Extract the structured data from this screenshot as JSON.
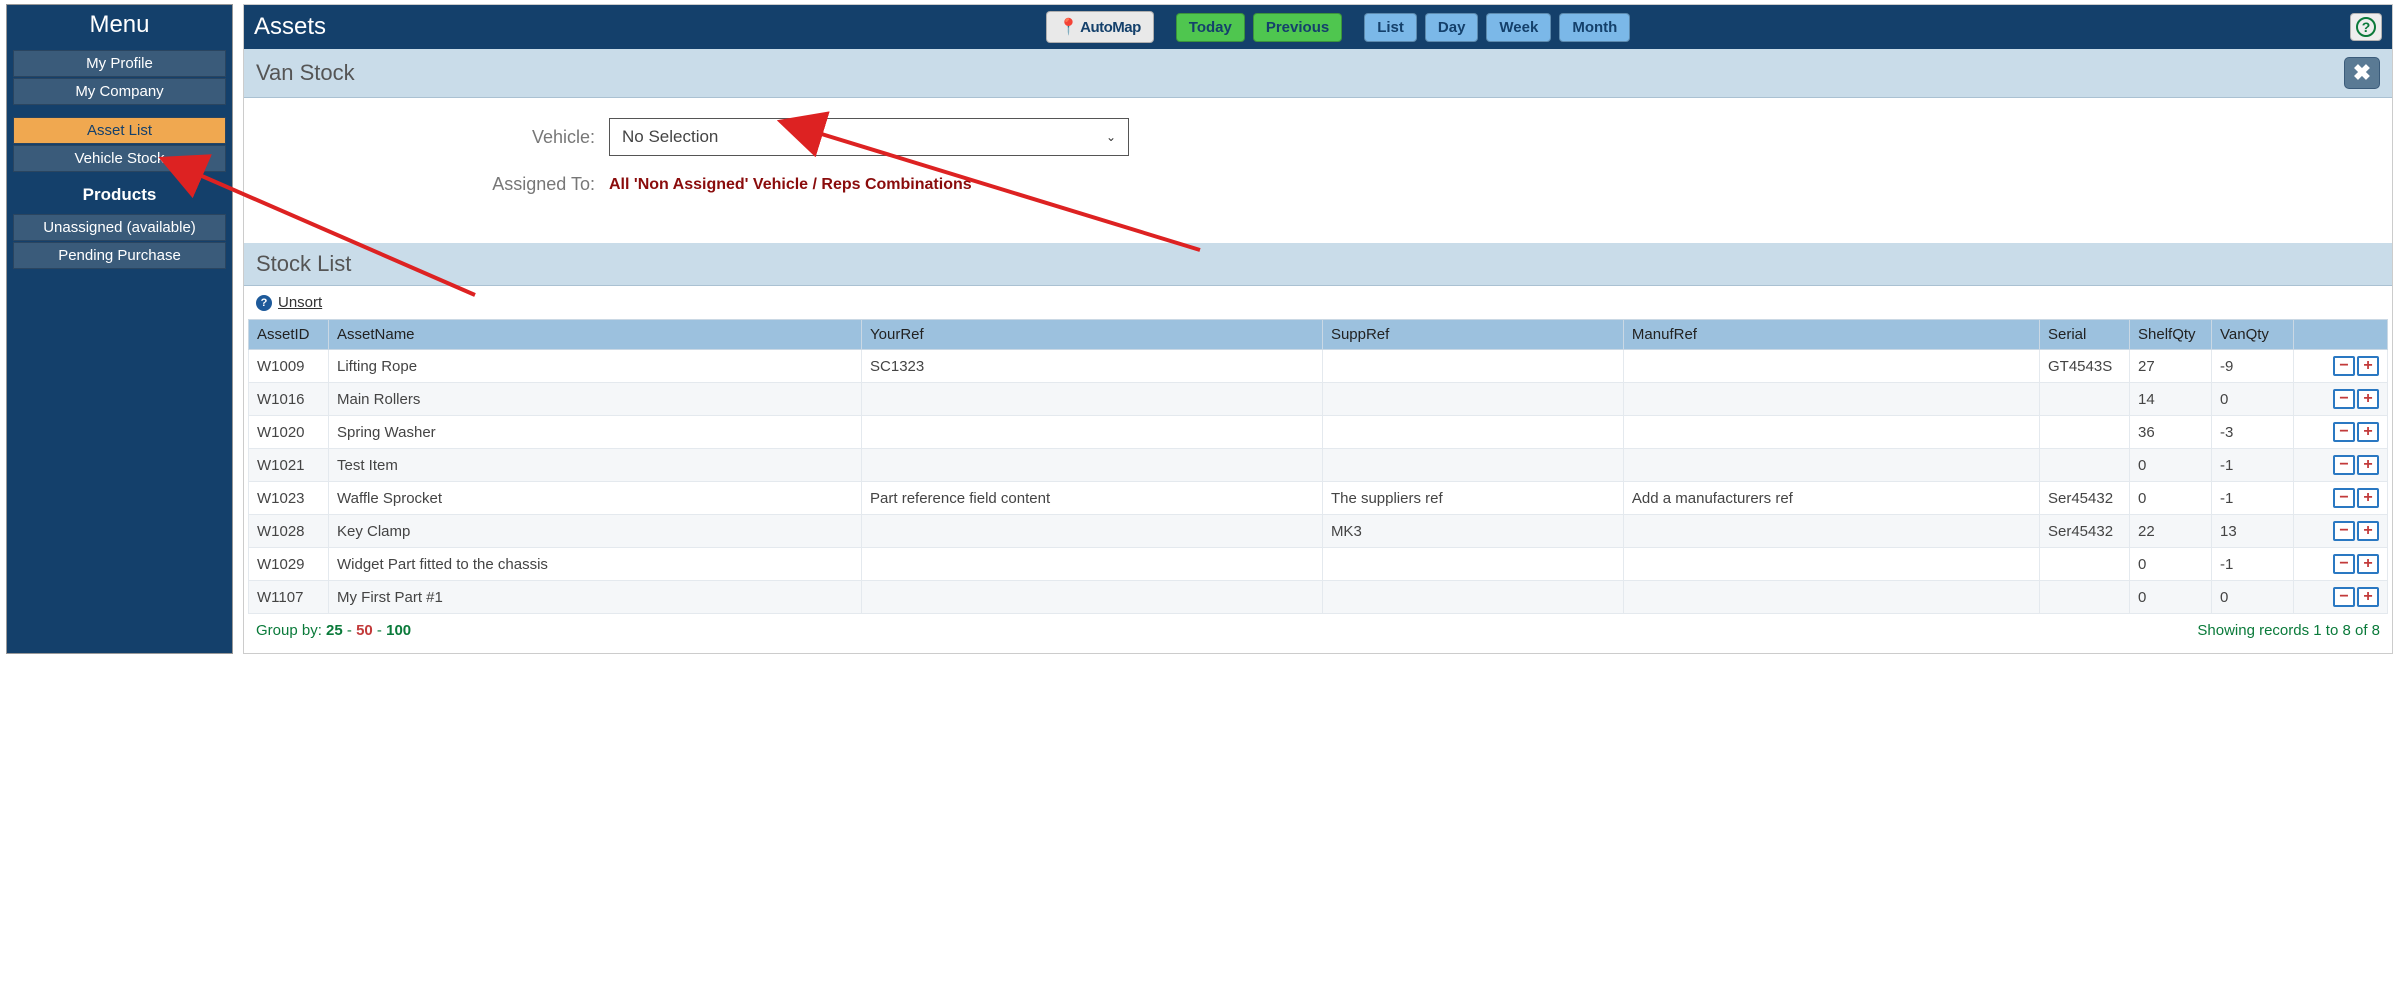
{
  "sidebar": {
    "title": "Menu",
    "items": [
      {
        "label": "My Profile",
        "active": false
      },
      {
        "label": "My Company",
        "active": false
      }
    ],
    "items2": [
      {
        "label": "Asset List",
        "active": true
      },
      {
        "label": "Vehicle Stock",
        "active": false
      }
    ],
    "products_section": "Products",
    "items3": [
      {
        "label": "Unassigned (available)",
        "active": false
      },
      {
        "label": "Pending Purchase",
        "active": false
      }
    ]
  },
  "header": {
    "title": "Assets",
    "automap": "AutoMap",
    "today": "Today",
    "previous": "Previous",
    "list": "List",
    "day": "Day",
    "week": "Week",
    "month": "Month",
    "help": "?"
  },
  "van_stock": {
    "title": "Van Stock",
    "vehicle_label": "Vehicle:",
    "vehicle_value": "No Selection",
    "assigned_label": "Assigned To:",
    "assigned_value": "All 'Non Assigned' Vehicle / Reps Combinations"
  },
  "stock_list": {
    "title": "Stock List",
    "unsort": "Unsort",
    "columns": {
      "asset_id": "AssetID",
      "asset_name": "AssetName",
      "your_ref": "YourRef",
      "supp_ref": "SuppRef",
      "manuf_ref": "ManufRef",
      "serial": "Serial",
      "shelf_qty": "ShelfQty",
      "van_qty": "VanQty"
    },
    "rows": [
      {
        "asset_id": "W1009",
        "asset_name": "Lifting Rope",
        "your_ref": "SC1323",
        "supp_ref": "",
        "manuf_ref": "",
        "serial": "GT4543S",
        "shelf_qty": "27",
        "van_qty": "-9"
      },
      {
        "asset_id": "W1016",
        "asset_name": "Main Rollers",
        "your_ref": "",
        "supp_ref": "",
        "manuf_ref": "",
        "serial": "",
        "shelf_qty": "14",
        "van_qty": "0"
      },
      {
        "asset_id": "W1020",
        "asset_name": "Spring Washer",
        "your_ref": "",
        "supp_ref": "",
        "manuf_ref": "",
        "serial": "",
        "shelf_qty": "36",
        "van_qty": "-3"
      },
      {
        "asset_id": "W1021",
        "asset_name": "Test Item",
        "your_ref": "",
        "supp_ref": "",
        "manuf_ref": "",
        "serial": "",
        "shelf_qty": "0",
        "van_qty": "-1"
      },
      {
        "asset_id": "W1023",
        "asset_name": "Waffle Sprocket",
        "your_ref": "Part reference field content",
        "supp_ref": "The suppliers ref",
        "manuf_ref": "Add a manufacturers ref",
        "serial": "Ser45432",
        "shelf_qty": "0",
        "van_qty": "-1"
      },
      {
        "asset_id": "W1028",
        "asset_name": "Key Clamp",
        "your_ref": "",
        "supp_ref": "MK3",
        "manuf_ref": "",
        "serial": "Ser45432",
        "shelf_qty": "22",
        "van_qty": "13"
      },
      {
        "asset_id": "W1029",
        "asset_name": "Widget Part fitted to the chassis",
        "your_ref": "",
        "supp_ref": "",
        "manuf_ref": "",
        "serial": "",
        "shelf_qty": "0",
        "van_qty": "-1"
      },
      {
        "asset_id": "W1107",
        "asset_name": "My First Part #1",
        "your_ref": "",
        "supp_ref": "",
        "manuf_ref": "",
        "serial": "",
        "shelf_qty": "0",
        "van_qty": "0"
      }
    ],
    "group_by_label": "Group by:",
    "group_by_options": [
      "25",
      "50",
      "100"
    ],
    "group_by_active": "50",
    "showing": "Showing records 1 to 8 of 8"
  }
}
